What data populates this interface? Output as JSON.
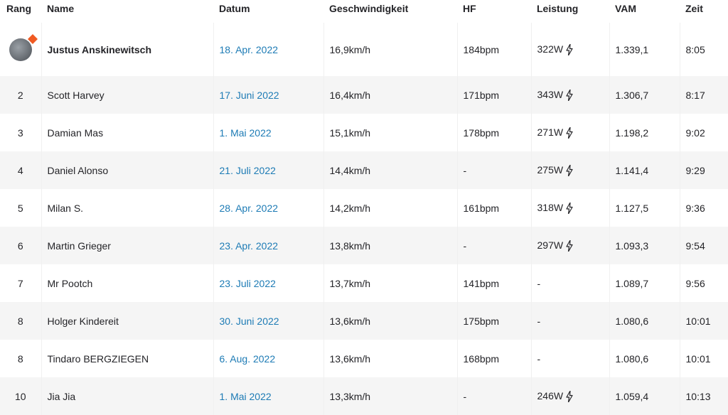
{
  "columns": {
    "rank": "Rang",
    "name": "Name",
    "date": "Datum",
    "speed": "Geschwindigkeit",
    "hr": "HF",
    "power": "Leistung",
    "vam": "VAM",
    "time": "Zeit"
  },
  "colors": {
    "link": "#1d7bb5",
    "badge": "#f05a22"
  },
  "rows": [
    {
      "rank": "",
      "name": "Justus Anskinewitsch",
      "date": "18. Apr. 2022",
      "speed": "16,9km/h",
      "hr": "184bpm",
      "power": "322W",
      "vam": "1.339,1",
      "time": "8:05"
    },
    {
      "rank": "2",
      "name": "Scott Harvey",
      "date": "17. Juni 2022",
      "speed": "16,4km/h",
      "hr": "171bpm",
      "power": "343W",
      "vam": "1.306,7",
      "time": "8:17"
    },
    {
      "rank": "3",
      "name": "Damian Mas",
      "date": "1. Mai 2022",
      "speed": "15,1km/h",
      "hr": "178bpm",
      "power": "271W",
      "vam": "1.198,2",
      "time": "9:02"
    },
    {
      "rank": "4",
      "name": "Daniel Alonso",
      "date": "21. Juli 2022",
      "speed": "14,4km/h",
      "hr": "-",
      "power": "275W",
      "vam": "1.141,4",
      "time": "9:29"
    },
    {
      "rank": "5",
      "name": "Milan S.",
      "date": "28. Apr. 2022",
      "speed": "14,2km/h",
      "hr": "161bpm",
      "power": "318W",
      "vam": "1.127,5",
      "time": "9:36"
    },
    {
      "rank": "6",
      "name": "Martin Grieger",
      "date": "23. Apr. 2022",
      "speed": "13,8km/h",
      "hr": "-",
      "power": "297W",
      "vam": "1.093,3",
      "time": "9:54"
    },
    {
      "rank": "7",
      "name": "Mr Pootch",
      "date": "23. Juli 2022",
      "speed": "13,7km/h",
      "hr": "141bpm",
      "power": "-",
      "vam": "1.089,7",
      "time": "9:56"
    },
    {
      "rank": "8",
      "name": "Holger Kindereit",
      "date": "30. Juni 2022",
      "speed": "13,6km/h",
      "hr": "175bpm",
      "power": "-",
      "vam": "1.080,6",
      "time": "10:01"
    },
    {
      "rank": "8",
      "name": "Tindaro BERGZIEGEN",
      "date": "6. Aug. 2022",
      "speed": "13,6km/h",
      "hr": "168bpm",
      "power": "-",
      "vam": "1.080,6",
      "time": "10:01"
    },
    {
      "rank": "10",
      "name": "Jia Jia",
      "date": "1. Mai 2022",
      "speed": "13,3km/h",
      "hr": "-",
      "power": "246W",
      "vam": "1.059,4",
      "time": "10:13"
    }
  ]
}
